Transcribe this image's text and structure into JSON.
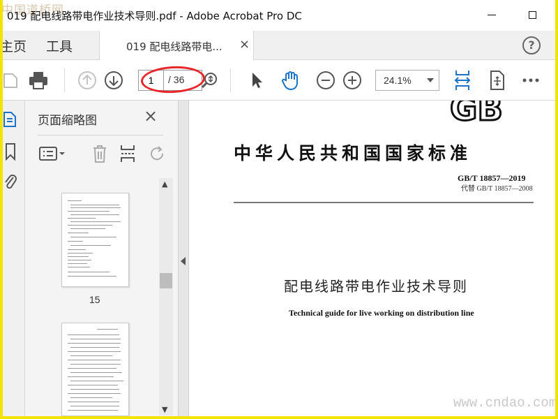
{
  "watermark": {
    "top": "中国道桥网",
    "bottom": "www.cndao.com"
  },
  "window": {
    "title": "019 配电线路带电作业技术导则.pdf - Adobe Acrobat Pro DC"
  },
  "menu": {
    "home_label": "主页",
    "tools_label": "工具"
  },
  "tab": {
    "label": "019 配电线路带电...",
    "close_glyph": "×"
  },
  "help": {
    "glyph": "?"
  },
  "toolbar": {
    "page_current": "1",
    "page_total": "/ 36",
    "zoom_value": "24.1%",
    "icons": [
      "save-icon",
      "print-icon",
      "previous-page-icon",
      "next-page-icon",
      "zoom-search-icon",
      "select-cursor-icon",
      "hand-tool-icon",
      "zoom-out-icon",
      "zoom-in-icon",
      "fit-width-icon",
      "page-rotate-icon",
      "more-icon"
    ]
  },
  "sidebar": {
    "panel_title": "页面缩略图",
    "close_glyph": "×",
    "thumbnails": [
      {
        "label": "15"
      },
      {
        "label": ""
      }
    ]
  },
  "document": {
    "logo_text": "GB",
    "standard_title": "中华人民共和国国家标准",
    "standard_number": "GB/T 18857—2019",
    "replaces": "代替 GB/T 18857—2008",
    "title_cn": "配电线路带电作业技术导则",
    "title_en": "Technical guide for live working on distribution line"
  },
  "colors": {
    "accent_blue": "#1a73c8",
    "highlight_red": "#e8262a",
    "frame_yellow": "#f2e400"
  }
}
